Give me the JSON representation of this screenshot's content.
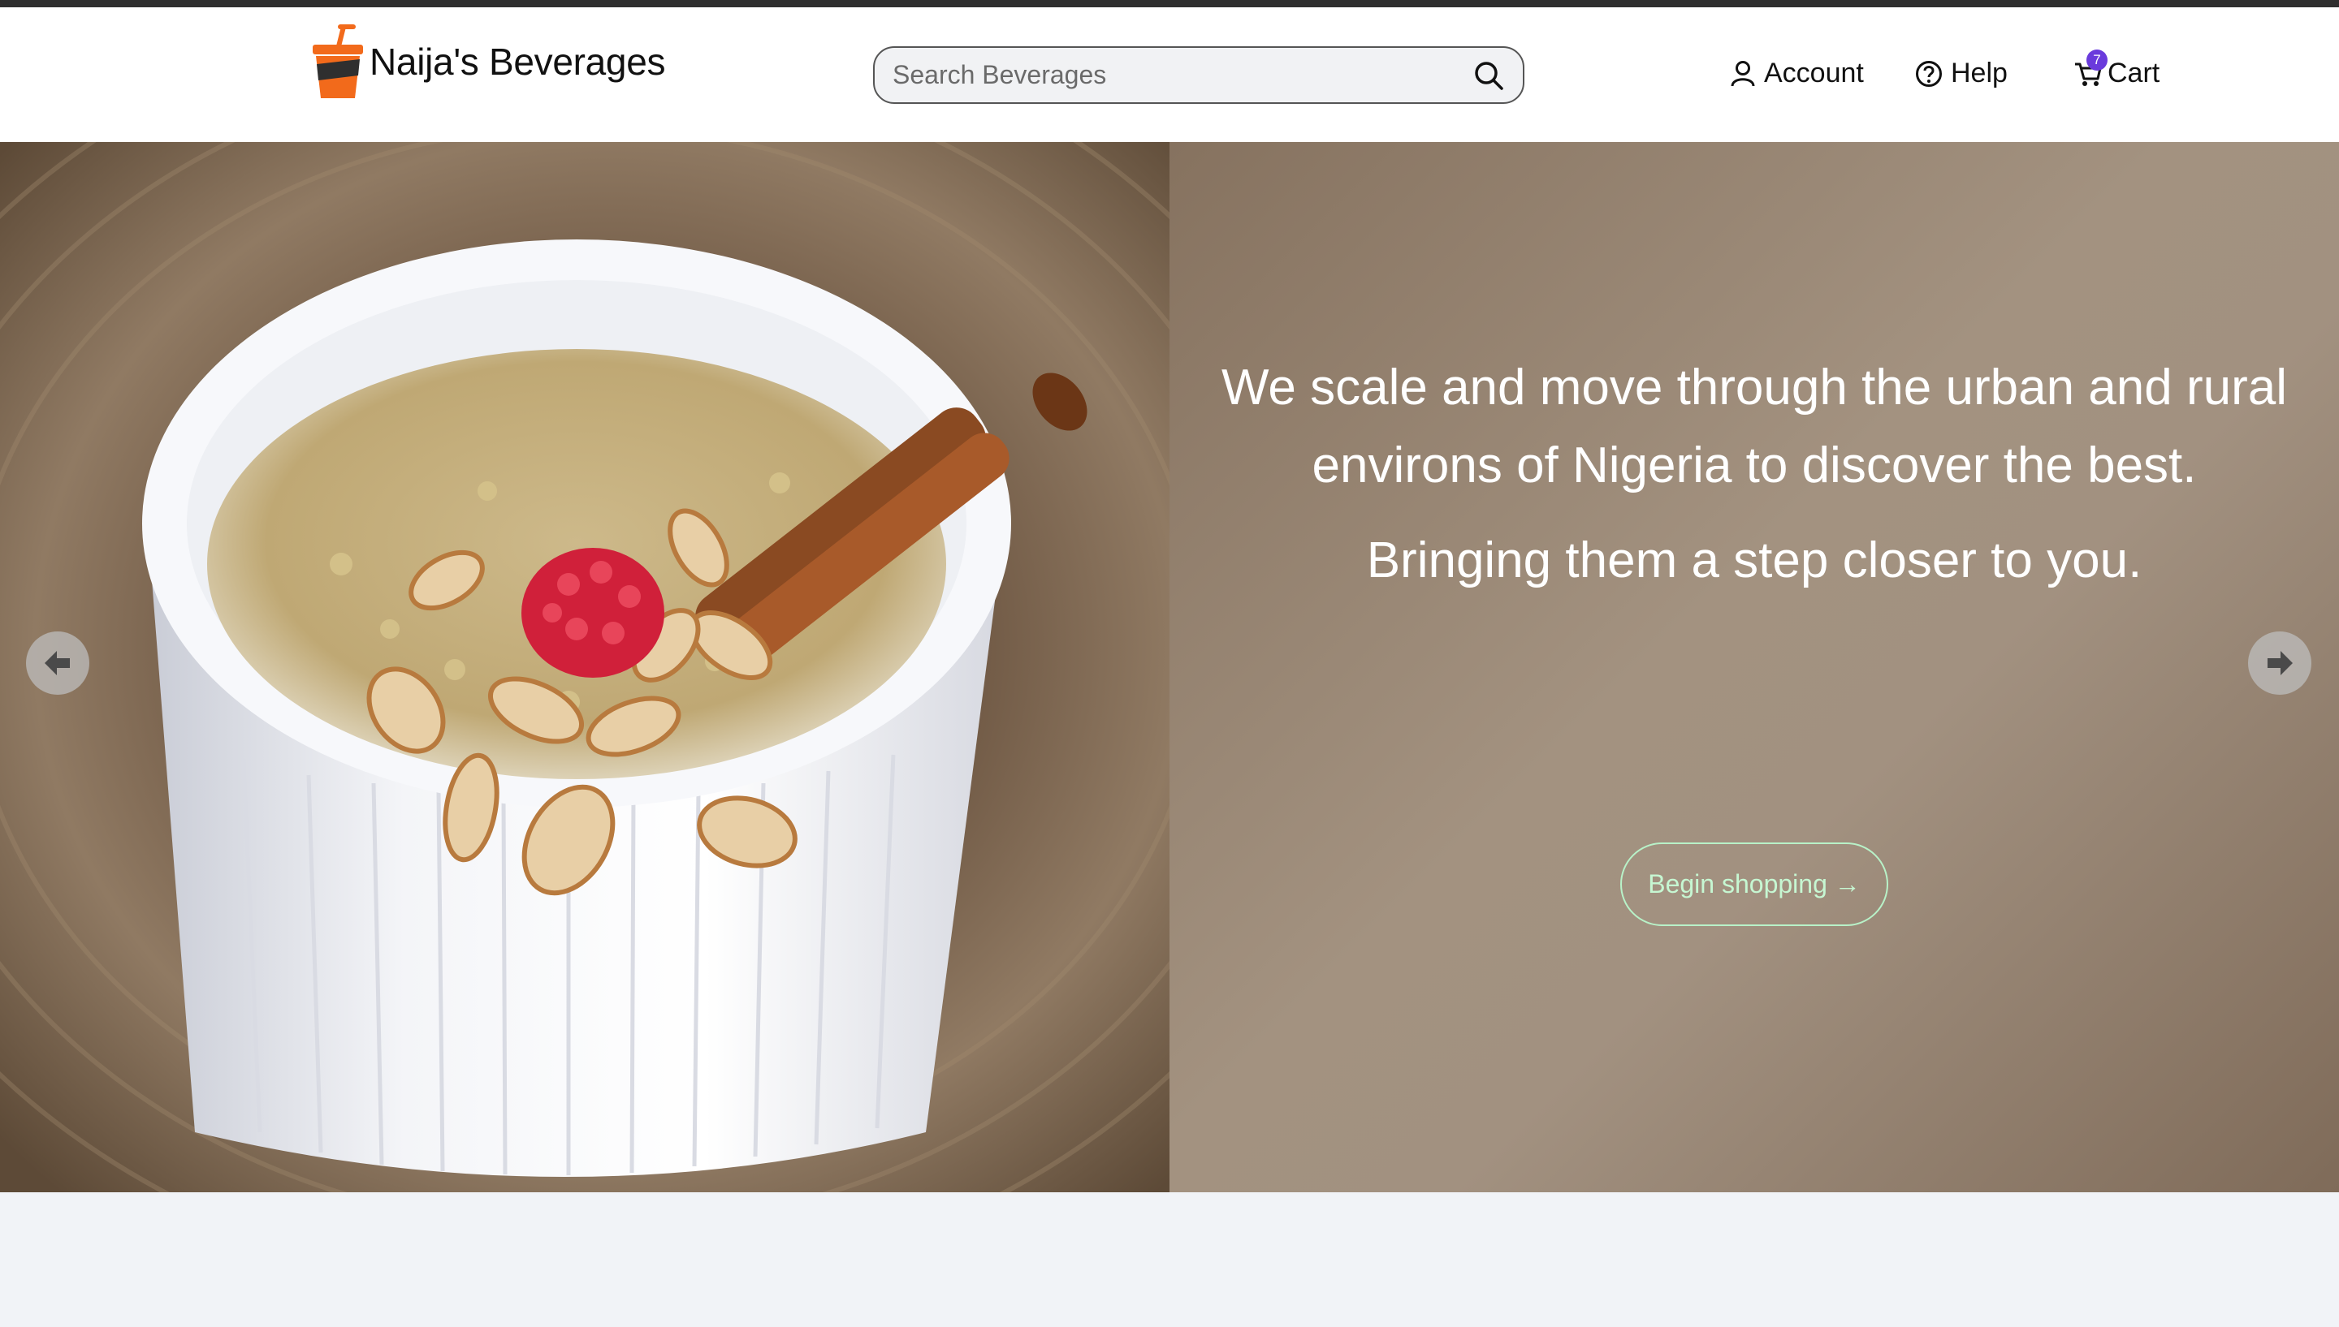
{
  "brand": {
    "name": "Naija's Beverages",
    "logo_icon": "drink-cup-icon",
    "accent": "#f26a1b"
  },
  "search": {
    "placeholder": "Search Beverages",
    "icon": "search-icon"
  },
  "nav": {
    "account_label": "Account",
    "help_label": "Help",
    "cart_label": "Cart",
    "cart_count": "7"
  },
  "hero": {
    "headline_line1": "We scale and move through the urban and rural",
    "headline_line2": "environs of Nigeria to discover the best.",
    "subheadline": "Bringing them a step closer to you.",
    "cta_label": "Begin shopping →",
    "cta_color": "#c6f7d2",
    "image_description_icon": "millet-porridge-photo"
  },
  "carousel": {
    "prev_icon": "arrow-left-icon",
    "next_icon": "arrow-right-icon"
  }
}
